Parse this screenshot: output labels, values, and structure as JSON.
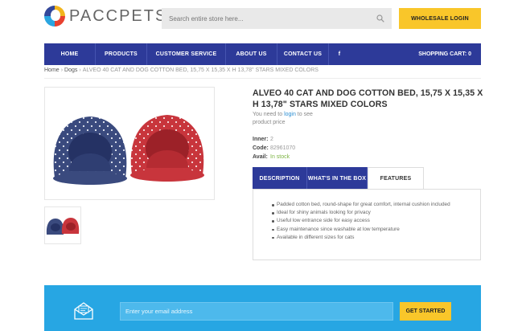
{
  "header": {
    "brand": "PACCPETS",
    "search_placeholder": "Search entire store here...",
    "wholesale_label": "WHOLESALE LOGIN"
  },
  "nav": {
    "items": [
      {
        "label": "HOME"
      },
      {
        "label": "PRODUCTS"
      },
      {
        "label": "CUSTOMER SERVICE"
      },
      {
        "label": "ABOUT US"
      },
      {
        "label": "CONTACT US"
      },
      {
        "label": "f"
      }
    ],
    "cart_label": "SHOPPING CART: 0"
  },
  "breadcrumb": {
    "home": "Home",
    "category": "Dogs",
    "current": "ALVEO 40 CAT AND DOG COTTON BED, 15,75 X 15,35 X H 13,78\" STARS MIXED COLORS"
  },
  "product": {
    "title": "ALVEO 40 CAT AND DOG COTTON BED, 15,75 X 15,35 X H 13,78\" STARS MIXED COLORS",
    "login_prefix": "You need to ",
    "login_link": "login",
    "login_suffix": " to see product price",
    "meta": [
      {
        "key": "Inner:",
        "value": "2"
      },
      {
        "key": "Code:",
        "value": "82961070"
      },
      {
        "key": "Avail:",
        "value": "In stock"
      }
    ],
    "colors": {
      "bed_blue": "#3a4a7e",
      "bed_red": "#c8353c"
    }
  },
  "tabs": {
    "items": [
      {
        "label": "DESCRIPTION"
      },
      {
        "label": "WHAT'S IN THE BOX"
      },
      {
        "label": "FEATURES"
      }
    ],
    "active": "FEATURES",
    "features": [
      "Padded cotton bed, round-shape for great comfort, internal cushion included",
      "Ideal for shiny animals looking for privacy",
      "Useful low entrance side for easy access",
      "Easy maintenance since washable at low temperature",
      "Available in different sizes for cats"
    ]
  },
  "newsletter": {
    "placeholder": "Enter your email address",
    "button_label": "GET STARTED"
  },
  "colors": {
    "nav_blue": "#2d3a99",
    "accent_yellow": "#f9c62a",
    "newsletter_blue": "#27a6e3"
  }
}
